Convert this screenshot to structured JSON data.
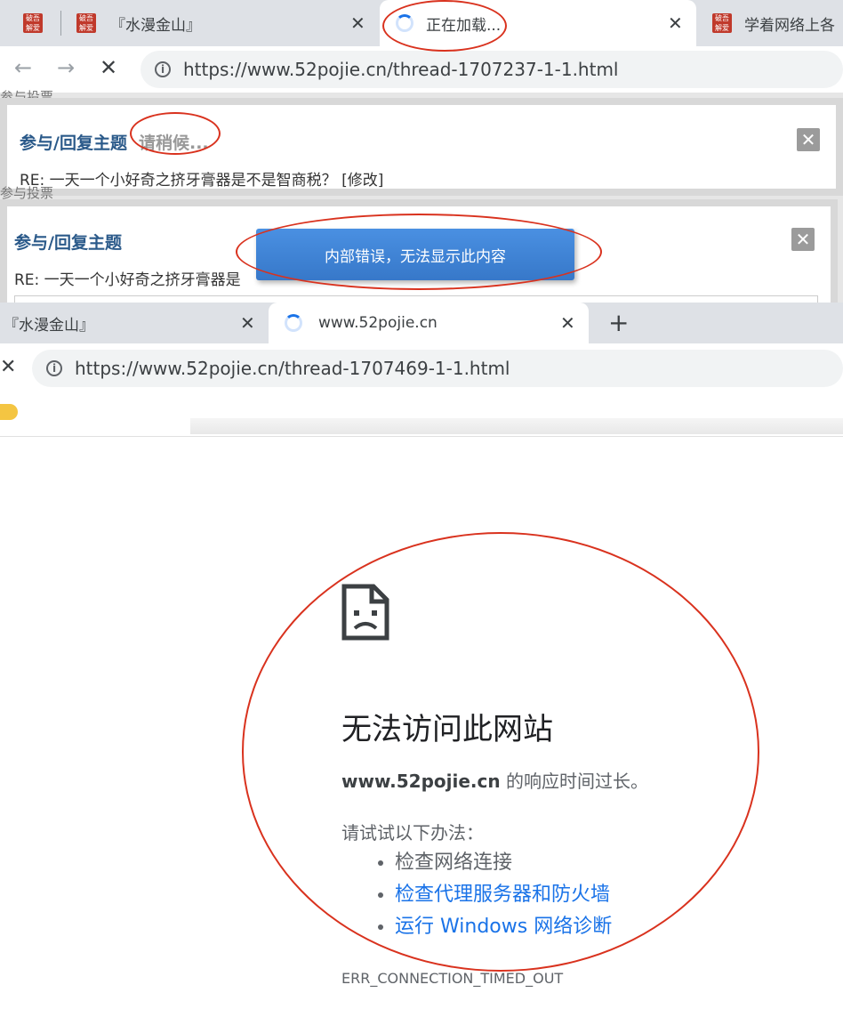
{
  "browser_top": {
    "tabs": [
      {
        "label": "『水漫金山』",
        "favicon": "52pojie-favicon"
      },
      {
        "label": "正在加载...",
        "favicon": "loading-spinner"
      },
      {
        "label": "学着网络上各",
        "favicon": "52pojie-favicon"
      }
    ],
    "url": "https://www.52pojie.cn/thread-1707237-1-1.html"
  },
  "dialog_one": {
    "title": "参与/回复主题",
    "status": "请稍候...",
    "subject": "RE: 一天一个小好奇之挤牙膏器是不是智商税？ [修改]"
  },
  "dialog_two": {
    "title": "参与/回复主题",
    "subject": "RE: 一天一个小好奇之挤牙膏器是"
  },
  "toast": {
    "message": "内部错误，无法显示此内容"
  },
  "browser_bottom": {
    "tabs": [
      {
        "label": "『水漫金山』"
      },
      {
        "label": "www.52pojie.cn"
      }
    ],
    "new_tab": "+",
    "url": "https://www.52pojie.cn/thread-1707469-1-1.html"
  },
  "error_page": {
    "title": "无法访问此网站",
    "host": "www.52pojie.cn",
    "message": " 的响应时间过长。",
    "try_label": "请试试以下办法：",
    "suggestions": [
      "检查网络连接",
      "检查代理服务器和防火墙",
      "运行 Windows 网络诊断"
    ],
    "error_code": "ERR_CONNECTION_TIMED_OUT"
  },
  "colors": {
    "accent": "#1a73e8",
    "annotation": "#d9321e",
    "dialog_title": "#2b5a8a"
  }
}
